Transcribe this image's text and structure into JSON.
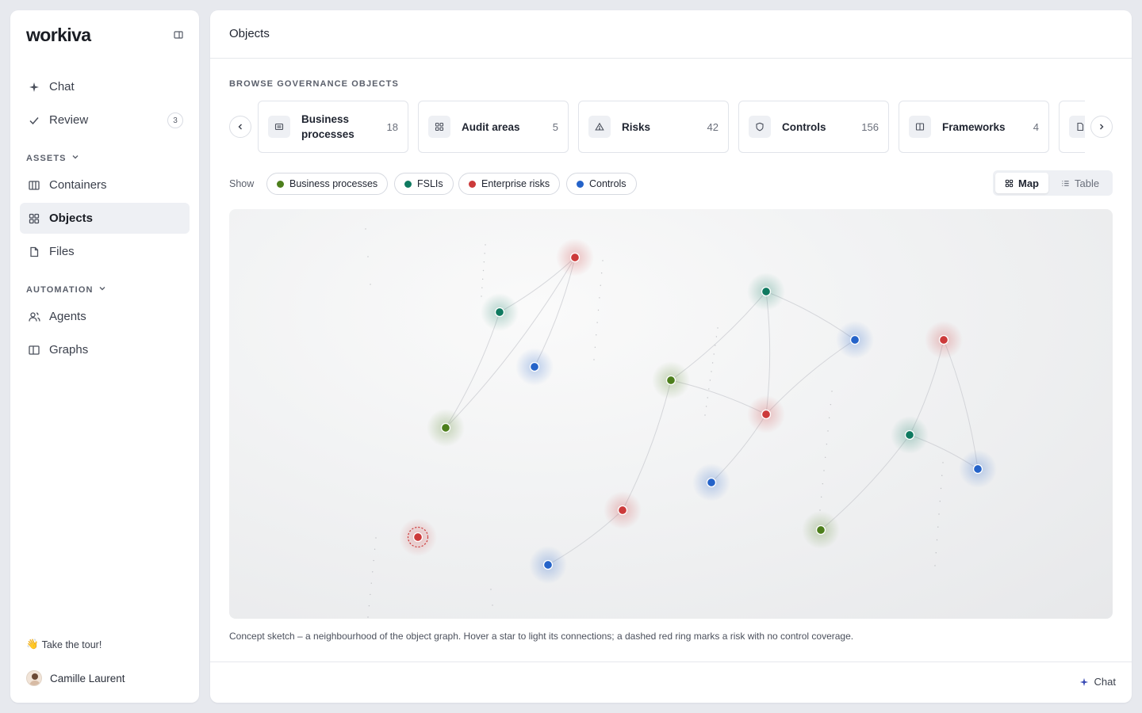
{
  "app": {
    "logo": "workiva"
  },
  "sidebar": {
    "nav_top": [
      {
        "label": "Chat",
        "icon": "sparkle-icon"
      },
      {
        "label": "Review",
        "icon": "check-icon",
        "badge": "3"
      }
    ],
    "assets_heading": "ASSETS",
    "assets": [
      {
        "label": "Containers",
        "icon": "columns-icon"
      },
      {
        "label": "Objects",
        "icon": "grid-icon",
        "active": true
      },
      {
        "label": "Files",
        "icon": "file-icon"
      }
    ],
    "automation_heading": "AUTOMATION",
    "automation": [
      {
        "label": "Agents",
        "icon": "users-icon"
      },
      {
        "label": "Graphs",
        "icon": "panel-icon"
      }
    ],
    "tour": {
      "emoji": "👋",
      "label": "Take the tour!"
    },
    "user": {
      "name": "Camille Laurent"
    }
  },
  "header": {
    "title": "Objects"
  },
  "browse": {
    "label": "BROWSE GOVERNANCE OBJECTS",
    "cards": [
      {
        "label": "Business processes",
        "count": "18",
        "icon": "list-icon"
      },
      {
        "label": "Audit areas",
        "count": "5",
        "icon": "grid-icon"
      },
      {
        "label": "Risks",
        "count": "42",
        "icon": "warning-icon"
      },
      {
        "label": "Controls",
        "count": "156",
        "icon": "shield-icon"
      },
      {
        "label": "Frameworks",
        "count": "4",
        "icon": "book-icon"
      }
    ]
  },
  "filters": {
    "show_label": "Show",
    "chips": [
      {
        "label": "Business processes",
        "color": "#4d7f1c"
      },
      {
        "label": "FSLIs",
        "color": "#0f7a60"
      },
      {
        "label": "Enterprise risks",
        "color": "#cc3a3a"
      },
      {
        "label": "Controls",
        "color": "#2563c9"
      }
    ]
  },
  "view_toggle": {
    "map_label": "Map",
    "table_label": "Table",
    "selected": "Map"
  },
  "colors": {
    "business_process": "#4d7f1c",
    "fsli": "#0f7a60",
    "risk": "#cc3a3a",
    "control": "#2563c9"
  },
  "graph": {
    "nodes": [
      {
        "id": "r1",
        "type": "risk"
      },
      {
        "id": "f1",
        "type": "fsli"
      },
      {
        "id": "c1",
        "type": "control"
      },
      {
        "id": "b1",
        "type": "business_process"
      },
      {
        "id": "f2",
        "type": "fsli"
      },
      {
        "id": "c2",
        "type": "control"
      },
      {
        "id": "b2",
        "type": "business_process"
      },
      {
        "id": "r2",
        "type": "risk"
      },
      {
        "id": "c3",
        "type": "control"
      },
      {
        "id": "r3",
        "type": "risk"
      },
      {
        "id": "c4",
        "type": "control"
      },
      {
        "id": "r4",
        "type": "risk"
      },
      {
        "id": "f3",
        "type": "fsli"
      },
      {
        "id": "c5",
        "type": "control"
      },
      {
        "id": "b3",
        "type": "business_process"
      },
      {
        "id": "r5",
        "type": "risk",
        "uncovered": true
      }
    ],
    "edges": [
      [
        "r1",
        "f1"
      ],
      [
        "r1",
        "c1"
      ],
      [
        "r1",
        "b1"
      ],
      [
        "f1",
        "b1"
      ],
      [
        "f2",
        "c2"
      ],
      [
        "f2",
        "b2"
      ],
      [
        "f2",
        "r2"
      ],
      [
        "b2",
        "r2"
      ],
      [
        "r2",
        "c2"
      ],
      [
        "r2",
        "c3"
      ],
      [
        "b2",
        "r3"
      ],
      [
        "r3",
        "c4"
      ],
      [
        "r4",
        "f3"
      ],
      [
        "r4",
        "c5"
      ],
      [
        "f3",
        "c5"
      ],
      [
        "f3",
        "b3"
      ]
    ]
  },
  "caption": "Concept sketch – a neighbourhood of the object graph. Hover a star to light its connections; a dashed red ring marks a risk with no control coverage.",
  "footer": {
    "chat_label": "Chat"
  }
}
